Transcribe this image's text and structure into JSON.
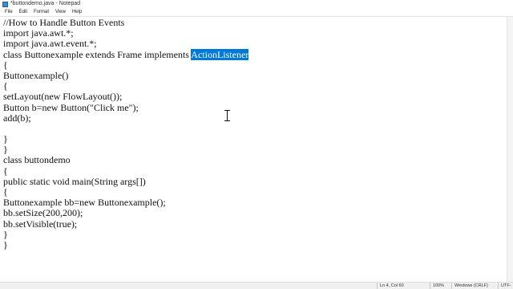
{
  "window": {
    "title": "*buttondemo.java - Notepad"
  },
  "menu": {
    "items": [
      "File",
      "Edit",
      "Format",
      "View",
      "Help"
    ]
  },
  "editor": {
    "lines": [
      "//How to Handle Button Events",
      "import java.awt.*;",
      "import java.awt.event.*;",
      "class Buttonexample extends Frame implements ",
      "{",
      "Buttonexample()",
      "{",
      "setLayout(new FlowLayout());",
      "Button b=new Button(\"Click me\");",
      "add(b);",
      "",
      "}",
      "}",
      "class buttondemo",
      "{",
      "public static void main(String args[])",
      "{",
      "Buttonexample bb=new Buttonexample();",
      "bb.setSize(200,200);",
      "bb.setVisible(true);",
      "}",
      "}"
    ],
    "selected_text": "ActionListener"
  },
  "status": {
    "position": "Ln 4, Col 60",
    "zoom": "100%",
    "line_ending": "Windows (CRLF)",
    "encoding": "UTF-"
  },
  "colors": {
    "selection": "#0078d7"
  }
}
